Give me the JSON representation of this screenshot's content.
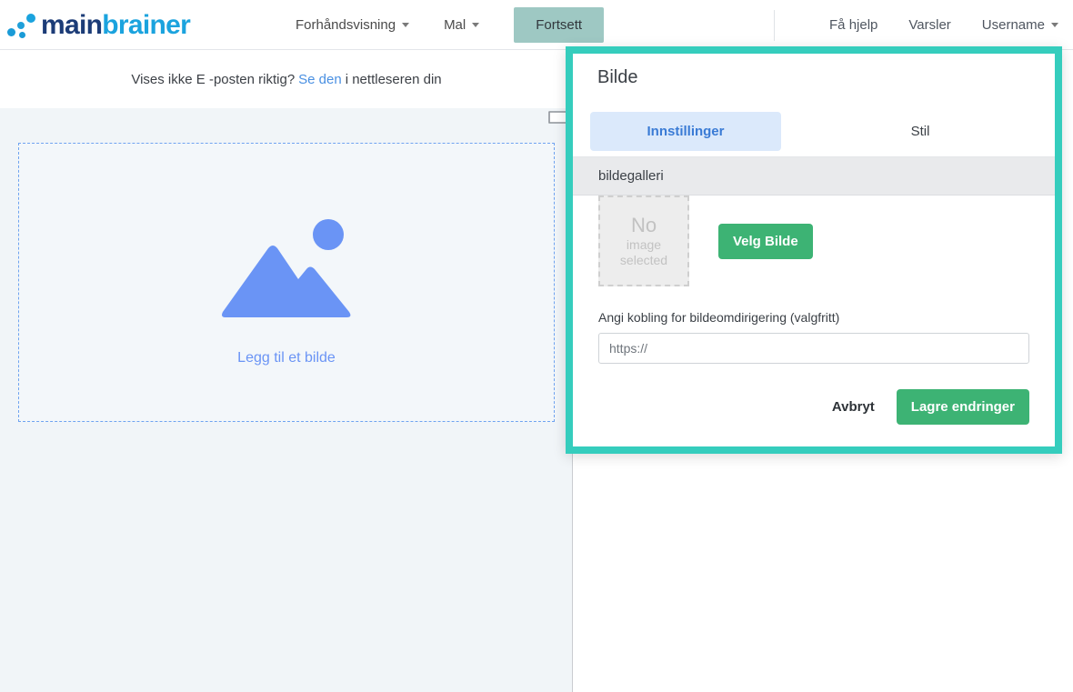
{
  "brand": {
    "name_part1": "main",
    "name_part2": "brainer",
    "logo_icon": "dots-logo-icon"
  },
  "topnav": {
    "preview_label": "Forhåndsvisning",
    "template_label": "Mal",
    "continue_label": "Fortsett",
    "help_label": "Få hjelp",
    "notifications_label": "Varsler",
    "user_label": "Username",
    "caret_icon": "chevron-down-icon",
    "continue_button_color": "#9ec8c3"
  },
  "preview_notice": {
    "text_before": "Vises ikke E -posten riktig?",
    "link_text": "Se den",
    "text_after": "i nettleseren din",
    "link_color": "#4a90e2"
  },
  "canvas": {
    "dropzone_label": "Legg til et bilde",
    "image_icon": "mountain-image-icon",
    "accent_color": "#6a94f5",
    "border_color": "#6fa3f0",
    "background_color": "#f1f5f8"
  },
  "panel": {
    "title": "Bilde",
    "border_color": "#35cdbd",
    "pointer_icon": "arrow-right-pointer-icon",
    "tabs": [
      {
        "label": "Innstillinger",
        "active": true
      },
      {
        "label": "Stil",
        "active": false
      }
    ],
    "section_header": "bildegalleri",
    "image_placeholder": {
      "line1": "No",
      "line2": "image",
      "line3": "selected"
    },
    "choose_image_label": "Velg Bilde",
    "choose_image_color": "#3db374",
    "url_field_label": "Angi kobling for bildeomdirigering (valgfritt)",
    "url_field_value": "",
    "url_field_placeholder": "https://",
    "cancel_label": "Avbryt",
    "save_label": "Lagre endringer",
    "save_color": "#3db374"
  }
}
